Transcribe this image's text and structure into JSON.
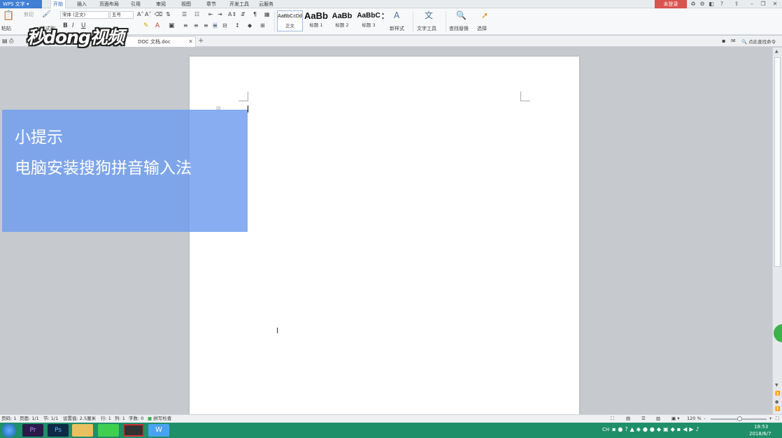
{
  "titlebar": {
    "app_name": "WPS 文字",
    "tabs": [
      {
        "label": "开始",
        "active": true
      },
      {
        "label": "插入"
      },
      {
        "label": "页面布局"
      },
      {
        "label": "引用"
      },
      {
        "label": "审阅"
      },
      {
        "label": "视图"
      },
      {
        "label": "章节"
      },
      {
        "label": "开发工具"
      },
      {
        "label": "云服务"
      }
    ],
    "login_label": "未登录"
  },
  "ribbon": {
    "paste_label": "粘贴",
    "cut_label": "剪切",
    "format_painter_label": "格式刷",
    "font_name": "宋体 (正文)",
    "font_size": "五号",
    "styles": [
      {
        "preview": "AaBbCcDd",
        "label": "正文"
      },
      {
        "preview": "AaBb",
        "label": "标题 1"
      },
      {
        "preview": "AaBb",
        "label": "标题 2"
      },
      {
        "preview": "AaBbC",
        "label": "标题 3"
      }
    ],
    "new_style_label": "新样式",
    "text_tools_label": "文字工具",
    "find_replace_label": "查找替换",
    "select_label": "选择"
  },
  "doctab": {
    "filename": "DOC 文档.doc",
    "search_cmd": "点此查找命令"
  },
  "overlay": {
    "tip_title": "小提示",
    "tip_body": "电脑安装搜狗拼音输入法",
    "logo_text": "秒dong视频"
  },
  "statusbar": {
    "page_num": "页码: 1",
    "pages": "页面: 1/1",
    "section": "节: 1/1",
    "position": "设置值: 2.5厘米",
    "row": "行: 1",
    "col": "列: 1",
    "word_count": "字数: 0",
    "spell_check": "拼写检查",
    "zoom": "120 %"
  },
  "taskbar": {
    "time": "18:53",
    "date": "2018/6/7",
    "tray_lang": "CH"
  },
  "colors": {
    "accent": "#3f7fd4",
    "overlay": "#6e9cee",
    "taskbar": "#1f8f6a",
    "login": "#d9534f"
  }
}
